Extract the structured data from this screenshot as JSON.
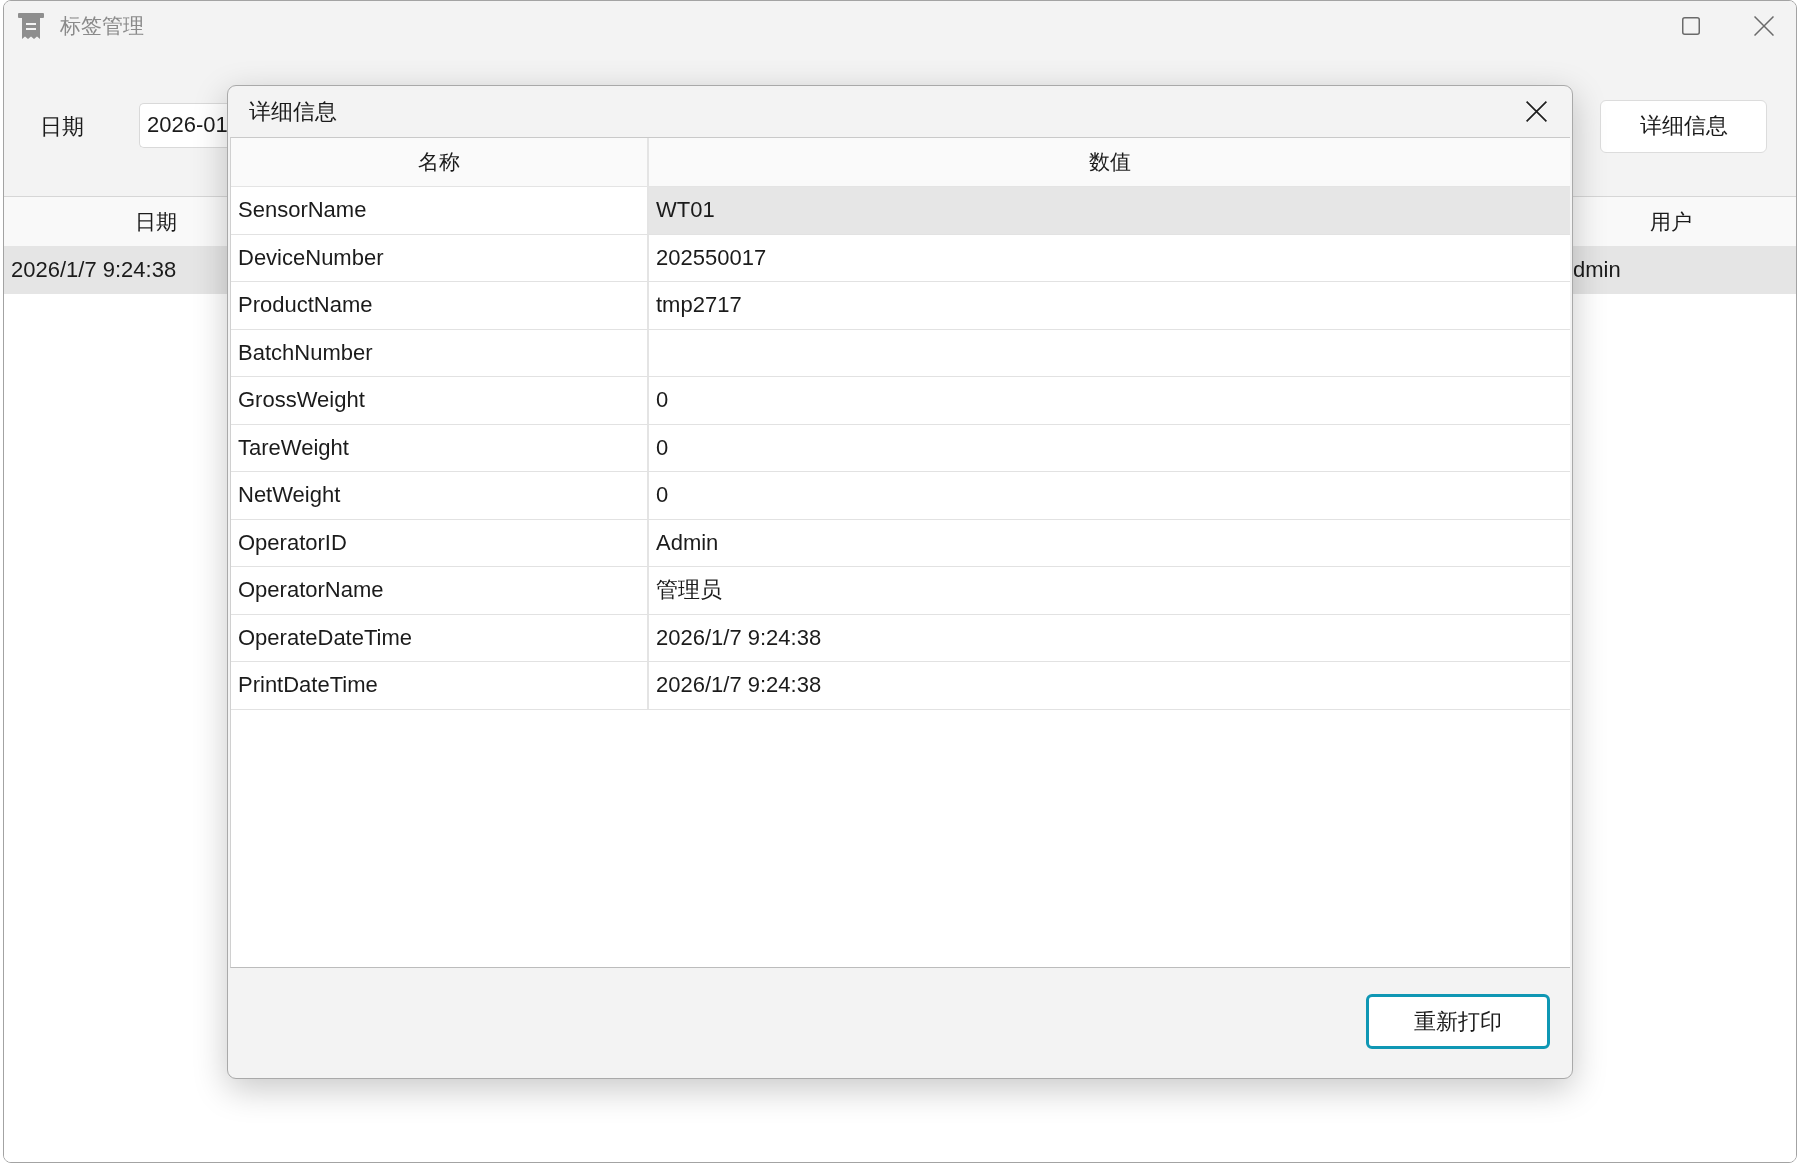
{
  "window": {
    "title": "标签管理"
  },
  "toolbar": {
    "date_label": "日期",
    "date_field": {
      "value": "2026-01"
    },
    "details_button": "详细信息"
  },
  "table": {
    "columns": [
      "日期",
      "用户"
    ],
    "rows": [
      {
        "cells": [
          "2026/1/7 9:24:38",
          "dmin"
        ],
        "selected": true
      }
    ]
  },
  "dialog": {
    "title": "详细信息",
    "columns": [
      "名称",
      "数值"
    ],
    "rows": [
      {
        "name": "SensorName",
        "value": "WT01",
        "selected": true
      },
      {
        "name": "DeviceNumber",
        "value": "202550017",
        "selected": false
      },
      {
        "name": "ProductName",
        "value": "tmp2717",
        "selected": false
      },
      {
        "name": "BatchNumber",
        "selected": false
      },
      {
        "name": "GrossWeight",
        "value": "0",
        "selected": false
      },
      {
        "name": "TareWeight",
        "value": "0",
        "selected": false
      },
      {
        "name": "NetWeight",
        "value": "0",
        "selected": false
      },
      {
        "name": "OperatorID",
        "value": "Admin",
        "selected": false
      },
      {
        "name": "OperatorName",
        "value": "管理员",
        "selected": false
      },
      {
        "name": "OperateDateTime",
        "value": "2026/1/7 9:24:38",
        "selected": false
      },
      {
        "name": "PrintDateTime",
        "value": "2026/1/7 9:24:38",
        "selected": false
      }
    ],
    "buttons": [
      {
        "label": "重新打印",
        "focused": true
      }
    ]
  }
}
